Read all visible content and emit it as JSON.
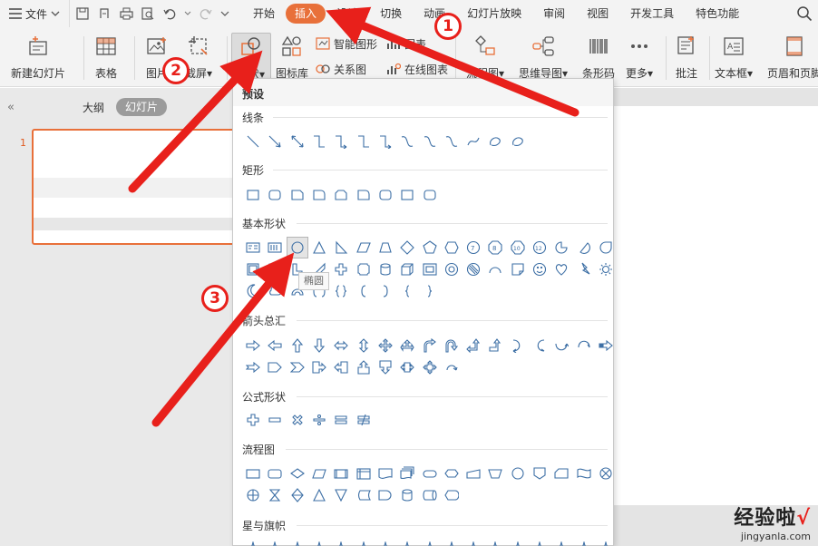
{
  "menubar": {
    "file_label": "文件",
    "tabs": [
      "开始",
      "插入",
      "设计",
      "切换",
      "动画",
      "幻灯片放映",
      "审阅",
      "视图",
      "开发工具",
      "特色功能"
    ],
    "active_tab": "插入"
  },
  "ribbon": {
    "new_slide": "新建幻灯片",
    "table": "表格",
    "picture": "图片",
    "screenshot": "截屏",
    "shapes": "形状",
    "icon_library": "图标库",
    "smart_graphic": "智能图形",
    "chart": "图表",
    "relation": "关系图",
    "online_chart": "在线图表",
    "flowchart": "流程图",
    "mindmap": "思维导图",
    "barcode": "条形码",
    "more": "更多",
    "comment": "批注",
    "textbox": "文本框",
    "header_footer": "页眉和页脚"
  },
  "left_panel": {
    "outline_tab": "大纲",
    "slides_tab": "幻灯片",
    "slide_number": "1"
  },
  "shapes_dropdown": {
    "header": "预设",
    "sections": [
      "线条",
      "矩形",
      "基本形状",
      "箭头总汇",
      "公式形状",
      "流程图",
      "星与旗帜"
    ],
    "tooltip": "椭圆"
  },
  "annotations": [
    "1",
    "2",
    "3"
  ],
  "watermark": {
    "main": "经验啦",
    "check": "√",
    "url": "jingyanla.com"
  },
  "colors": {
    "accent": "#e8703a",
    "arrow": "#e8201b",
    "shape_stroke": "#3d6fa5"
  }
}
